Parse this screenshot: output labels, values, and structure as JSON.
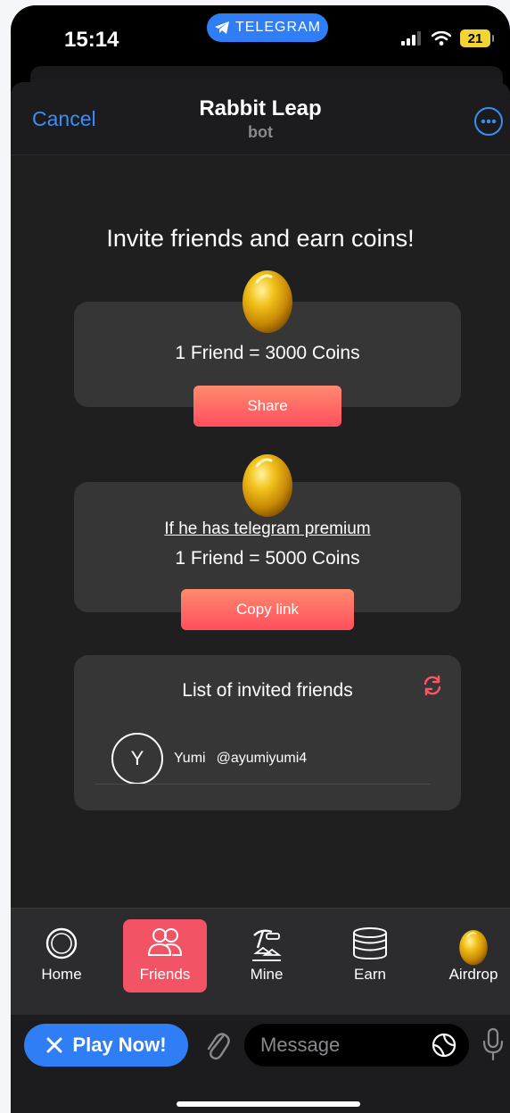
{
  "status": {
    "time": "15:14",
    "pill_label": "TELEGRAM",
    "battery": "21"
  },
  "header": {
    "cancel": "Cancel",
    "title": "Rabbit Leap",
    "subtitle": "bot"
  },
  "main": {
    "heading": "Invite friends and earn coins!",
    "card1": {
      "reward": "1 Friend = 3000 Coins",
      "button": "Share"
    },
    "card2": {
      "condition": "If he has telegram premium",
      "reward": "1 Friend = 5000 Coins",
      "button": "Copy link"
    },
    "friends_card": {
      "title": "List of invited friends",
      "friends": [
        {
          "initial": "Y",
          "name": "Yumi",
          "handle": "@ayumiyumi4"
        }
      ]
    }
  },
  "nav": {
    "items": [
      {
        "label": "Home",
        "icon": "home-ring-icon"
      },
      {
        "label": "Friends",
        "icon": "friends-icon",
        "active": true
      },
      {
        "label": "Mine",
        "icon": "pickaxe-gold-icon"
      },
      {
        "label": "Earn",
        "icon": "coin-stack-icon"
      },
      {
        "label": "Airdrop",
        "icon": "golden-egg-icon"
      }
    ]
  },
  "message_bar": {
    "play_button": "Play Now!",
    "placeholder": "Message"
  },
  "colors": {
    "accent_blue": "#2f7ef5",
    "button_gradient_top": "#ff8a6e",
    "button_gradient_bottom": "#ff4f5e",
    "active_nav": "#f25465"
  }
}
